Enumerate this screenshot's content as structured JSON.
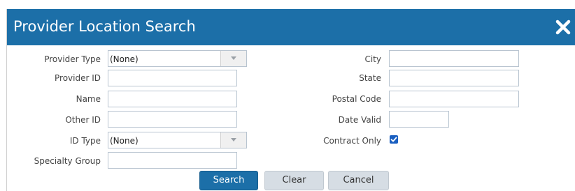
{
  "dialog": {
    "title": "Provider Location Search",
    "close_icon": "close-x-icon"
  },
  "fields": {
    "provider_type": {
      "label": "Provider Type",
      "value": "(None)"
    },
    "provider_id": {
      "label": "Provider ID",
      "value": ""
    },
    "name": {
      "label": "Name",
      "value": ""
    },
    "other_id": {
      "label": "Other ID",
      "value": ""
    },
    "id_type": {
      "label": "ID Type",
      "value": "(None)"
    },
    "specialty_group": {
      "label": "Specialty Group",
      "value": ""
    },
    "city": {
      "label": "City",
      "value": ""
    },
    "state": {
      "label": "State",
      "value": ""
    },
    "postal_code": {
      "label": "Postal Code",
      "value": ""
    },
    "date_valid": {
      "label": "Date Valid",
      "value": ""
    },
    "contract_only": {
      "label": "Contract Only",
      "checked": true
    }
  },
  "buttons": {
    "search": "Search",
    "clear": "Clear",
    "cancel": "Cancel"
  },
  "colors": {
    "accent": "#1c6fa8",
    "checkbox": "#1a5fc0"
  }
}
